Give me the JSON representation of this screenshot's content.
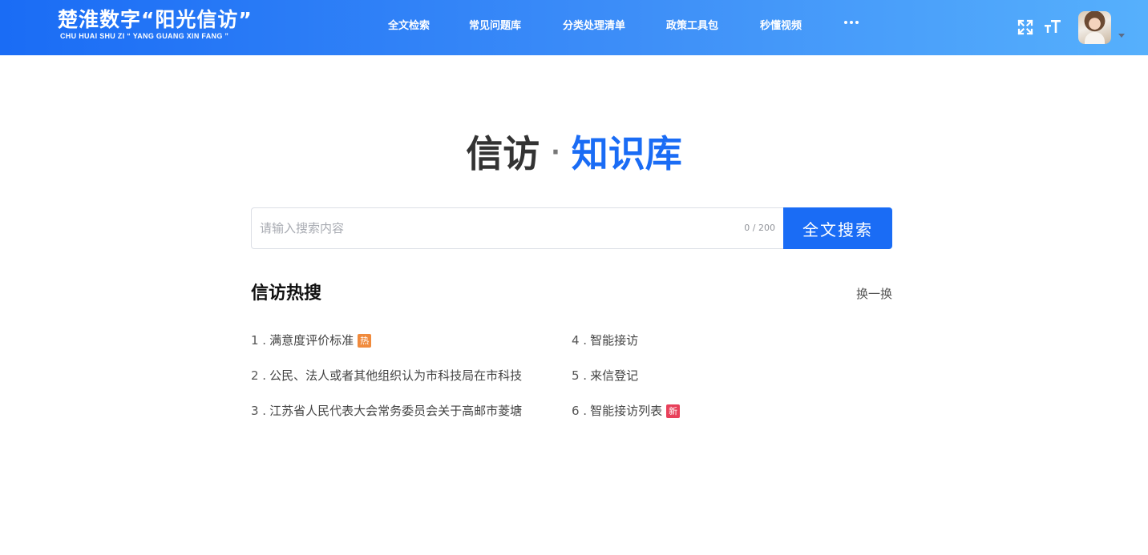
{
  "header": {
    "logo_cn": "楚淮数字“阳光信访”",
    "logo_en": "CHU HUAI SHU ZI  “ YANG GUANG XIN FANG ”",
    "nav": [
      {
        "label": "全文检索"
      },
      {
        "label": "常见问题库"
      },
      {
        "label": "分类处理清单"
      },
      {
        "label": "政策工具包"
      },
      {
        "label": "秒懂视频"
      }
    ],
    "fullscreen_icon": "fullscreen-icon",
    "font_size_icon": "font-size-icon",
    "more_icon": "more-icon"
  },
  "title": {
    "part1": "信访",
    "dot": "·",
    "part2": "知识库"
  },
  "search": {
    "placeholder": "请输入搜索内容",
    "value": "",
    "count": "0 / 200",
    "button": "全文搜索"
  },
  "hot": {
    "title": "信访热搜",
    "refresh": "换一换",
    "items": [
      {
        "num": "1 .",
        "text": "满意度评价标准",
        "badge": "热"
      },
      {
        "num": "2 .",
        "text": "公民、法人或者其他组织认为市科技局在市科技",
        "badge": ""
      },
      {
        "num": "3 .",
        "text": "江苏省人民代表大会常务委员会关于高邮市菱塘",
        "badge": ""
      },
      {
        "num": "4 .",
        "text": "智能接访",
        "badge": ""
      },
      {
        "num": "5 .",
        "text": "来信登记",
        "badge": ""
      },
      {
        "num": "6 .",
        "text": "智能接访列表",
        "badge": "新"
      }
    ]
  },
  "colors": {
    "brand": "#1a6cf5",
    "hot_badge": "#f08a3c",
    "new_badge": "#e8405a"
  }
}
